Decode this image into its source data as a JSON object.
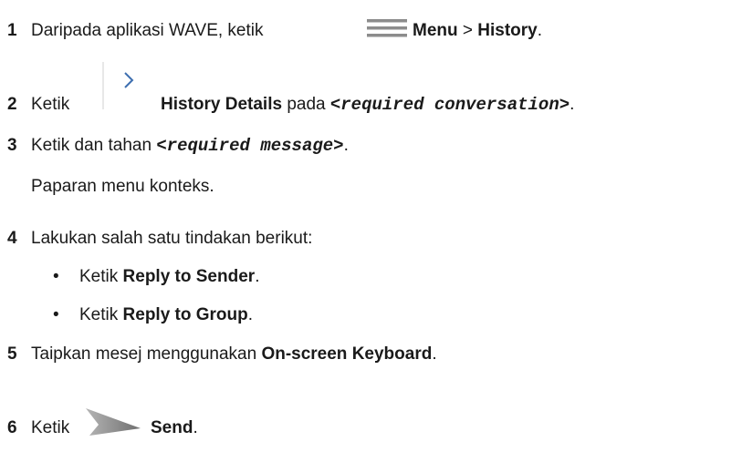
{
  "steps": [
    {
      "number": "1",
      "parts": {
        "a": "Daripada aplikasi WAVE, ketik",
        "b": "Menu",
        "c": " > ",
        "d": "History",
        "e": "."
      }
    },
    {
      "number": "2",
      "parts": {
        "a": "Ketik",
        "b": "History Details",
        "c": " pada ",
        "d": "<required conversation>",
        "e": "."
      }
    },
    {
      "number": "3",
      "parts": {
        "a": "Ketik dan tahan ",
        "b": "<required message>",
        "c": "."
      },
      "sub": "Paparan menu konteks."
    },
    {
      "number": "4",
      "parts": {
        "a": "Lakukan salah satu tindakan berikut:"
      },
      "bullets": [
        {
          "dot": "•",
          "a": "Ketik ",
          "b": "Reply to Sender",
          "c": "."
        },
        {
          "dot": "•",
          "a": "Ketik ",
          "b": "Reply to Group",
          "c": "."
        }
      ]
    },
    {
      "number": "5",
      "parts": {
        "a": "Taipkan mesej menggunakan ",
        "b": "On-screen Keyboard",
        "c": "."
      }
    },
    {
      "number": "6",
      "parts": {
        "a": "Ketik",
        "b": "Send",
        "c": "."
      }
    }
  ],
  "icons": {
    "menu": "menu-icon",
    "chevron": "chevron-right-icon",
    "send": "send-icon"
  },
  "colors": {
    "text": "#1a1a1a",
    "icon_gray": "#8c8c8c",
    "divider": "#d0d0d0"
  }
}
